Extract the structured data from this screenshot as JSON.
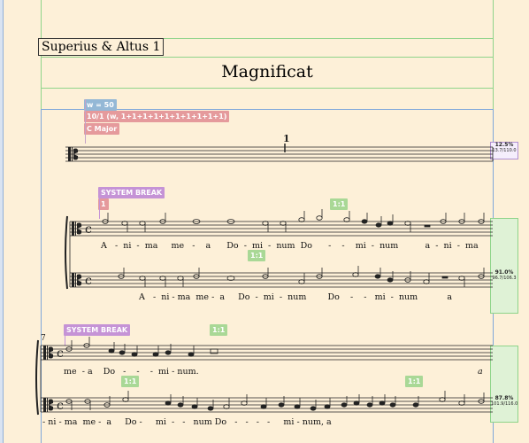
{
  "part_name": "Superius & Altus 1",
  "piece_title": "Magnificat",
  "tags": {
    "width": "w = 50",
    "divisions": "10/1 (w, 1+1+1+1+1+1+1+1+1+1)",
    "key": "C Major",
    "system_break_1": "SYSTEM BREAK",
    "system_break_1_num": "1",
    "system_break_2": "SYSTEM BREAK",
    "ratio_1": "1:1",
    "ratio_2": "1:1",
    "ratio_3": "1:1",
    "ratio_4": "1:1",
    "ratio_5": "1:1"
  },
  "measure_numbers": {
    "first": "1",
    "system2": "7"
  },
  "stats": {
    "s1_pct": "12.5%",
    "s1_val": "13.7/110.0",
    "s2_pct": "91.0%",
    "s2_val": "96.7/106.3",
    "s3_pct": "87.8%",
    "s3_val": "101.9/116.0"
  },
  "lyrics": {
    "sys1_upper": [
      "A",
      "-",
      "ni",
      "-",
      "ma",
      "me",
      "-",
      "a",
      "Do",
      "-",
      "mi",
      "-",
      "num",
      "Do",
      "-",
      "-",
      "mi",
      "-",
      "num",
      "a",
      "-",
      "ni",
      "-",
      "ma"
    ],
    "sys1_lower": [
      "A",
      "-",
      "ni",
      "-",
      "ma",
      "me",
      "-",
      "a",
      "Do",
      "-",
      "mi",
      "-",
      "num",
      "Do",
      "-",
      "-",
      "mi",
      "-",
      "num",
      "a"
    ],
    "sys2_upper": [
      "me",
      "-",
      "a",
      "Do",
      "-",
      "-",
      "-",
      "mi",
      "-",
      "num.",
      "a"
    ],
    "sys2_lower": [
      "-",
      "ni",
      "-",
      "ma",
      "me",
      "-",
      "a",
      "Do",
      "-",
      "mi",
      "-",
      "-",
      "num",
      "Do",
      "-",
      "-",
      "-",
      "-",
      "mi",
      "-",
      "num,",
      "a"
    ]
  }
}
